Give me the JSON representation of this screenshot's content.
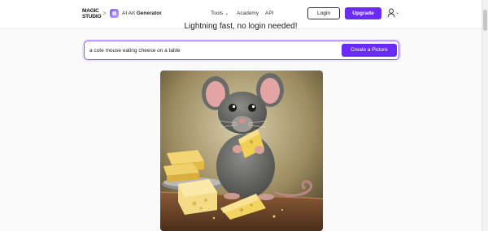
{
  "header": {
    "logo_line1": "MAGIC",
    "logo_line2": "STUDIO",
    "breadcrumb_separator": ">",
    "app_title_prefix": "AI Art",
    "app_title_bold": "Generator",
    "nav": {
      "tools": "Tools",
      "academy": "Academy",
      "api": "API"
    },
    "login_label": "Login",
    "upgrade_label": "Upgrade"
  },
  "main": {
    "subtitle": "Lightning fast, no login needed!",
    "prompt_value": "a cute mouse eating cheese on a table",
    "create_label": "Create a Picture"
  },
  "colors": {
    "accent": "#6a2cf5",
    "prompt_border": "#8a5cf6"
  },
  "icons": {
    "app": "ai-art-generator-icon",
    "user": "user-icon",
    "dropdown": "chevron-down-icon"
  }
}
